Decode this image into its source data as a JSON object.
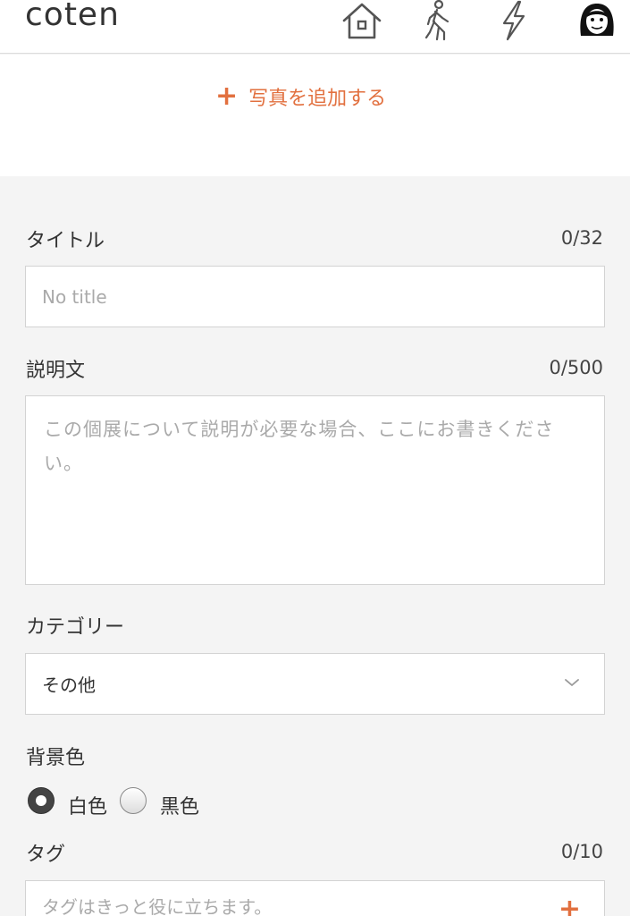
{
  "header": {
    "logo": "coten",
    "icons": [
      "home-icon",
      "walking-person-icon",
      "lightning-icon",
      "avatar"
    ]
  },
  "add_photo": {
    "plus": "+",
    "label": "写真を追加する"
  },
  "form": {
    "title": {
      "label": "タイトル",
      "counter": "0/32",
      "placeholder": "No title",
      "value": ""
    },
    "description": {
      "label": "説明文",
      "counter": "0/500",
      "placeholder": "この個展について説明が必要な場合、ここにお書きください。",
      "value": ""
    },
    "category": {
      "label": "カテゴリー",
      "selected": "その他"
    },
    "background_color": {
      "label": "背景色",
      "options": [
        {
          "label": "白色",
          "checked": true
        },
        {
          "label": "黒色",
          "checked": false
        }
      ]
    },
    "tags": {
      "label": "タグ",
      "counter": "0/10",
      "placeholder": "タグはきっと役に立ちます。",
      "plus": "+"
    }
  },
  "colors": {
    "accent": "#e2703f",
    "background": "#f4f4f4"
  }
}
